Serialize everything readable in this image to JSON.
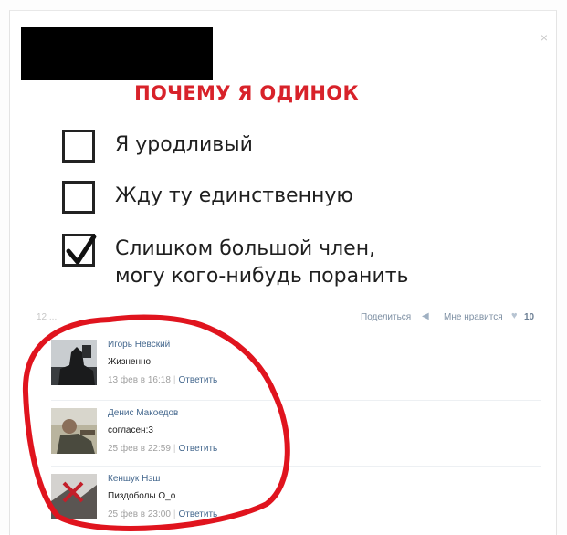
{
  "post": {
    "title": "ПОЧЕМУ Я ОДИНОК",
    "options": [
      {
        "label": "Я уродливый",
        "checked": false
      },
      {
        "label": "Жду ту единственную",
        "checked": false
      },
      {
        "label_line1": "Слишком большой член,",
        "label_line2": "могу кого-нибудь поранить",
        "checked": true
      }
    ],
    "close_icon": "×"
  },
  "meta": {
    "date": "12 ...",
    "share_label": "Поделиться",
    "share_icon": "megaphone-icon",
    "like_label": "Мне нравится",
    "like_icon": "heart-icon",
    "like_count": "10"
  },
  "comments": [
    {
      "author": "Игорь Невский",
      "text": "Жизненно",
      "date": "13 фев в 16:18",
      "reply": "Ответить"
    },
    {
      "author": "Денис Макоедов",
      "text": "согласен:3",
      "date": "25 фев в 22:59",
      "reply": "Ответить"
    },
    {
      "author": "Кеншук Нэш",
      "text": "Пиздоболы О_о",
      "date": "25 фев в 23:00",
      "reply": "Ответить"
    }
  ],
  "colors": {
    "title": "#d8222a",
    "link": "#45688e",
    "annotation_circle": "#e0141e"
  }
}
